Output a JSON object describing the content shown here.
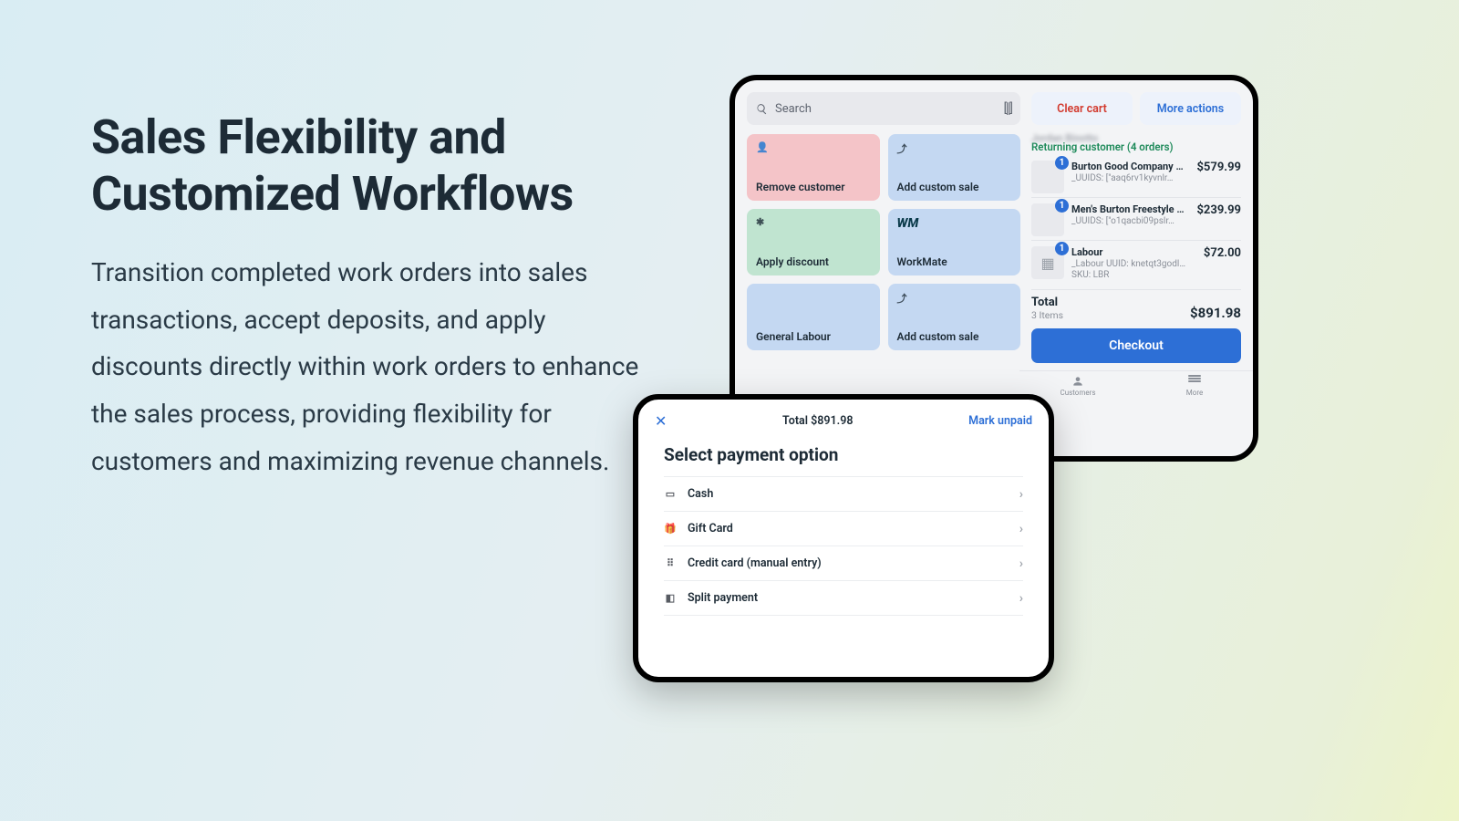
{
  "copy": {
    "title": "Sales Flexibility and Customized Workflows",
    "body": "Transition completed work orders into sales transactions, accept deposits, and apply discounts directly within work orders to enhance the sales process, providing flexibility for customers and maximizing revenue channels."
  },
  "pos": {
    "search_placeholder": "Search",
    "clear_label": "Clear cart",
    "more_label": "More actions",
    "customer_name": "Jordan Binotto",
    "returning": "Returning customer (4 orders)",
    "tiles": [
      {
        "label": "Remove customer",
        "color": "t-pink",
        "icon": "person-remove-icon",
        "glyph": "👤"
      },
      {
        "label": "Add custom sale",
        "color": "t-blue",
        "icon": "upload-icon",
        "glyph": "⤴"
      },
      {
        "label": "Apply discount",
        "color": "t-green",
        "icon": "discount-icon",
        "glyph": "✱"
      },
      {
        "label": "WorkMate",
        "color": "t-lblue",
        "icon": "workmate-icon",
        "glyph": "WM"
      },
      {
        "label": "General Labour",
        "color": "t-blue",
        "icon": "labour-icon",
        "glyph": ""
      },
      {
        "label": "Add custom sale",
        "color": "t-blue",
        "icon": "upload-icon",
        "glyph": "⤴"
      }
    ],
    "items": [
      {
        "qty": "1",
        "name": "Burton Good Company Camber…",
        "uuid": "_UUIDS: [\"aaq6rv1kyvnlr…",
        "price": "$579.99",
        "thumb": "ski"
      },
      {
        "qty": "1",
        "name": "Men's Burton Freestyle Re:Flex S…",
        "uuid": "_UUIDS: [\"o1qacbi09pslr…",
        "price": "$239.99",
        "thumb": "binding"
      },
      {
        "qty": "1",
        "name": "Labour",
        "uuid": "_Labour UUID: knetqt3godl…",
        "sku": "SKU: LBR",
        "price": "$72.00",
        "thumb": "blank"
      }
    ],
    "total_label": "Total",
    "total_items": "3 Items",
    "total_value": "$891.98",
    "checkout": "Checkout",
    "nav": [
      {
        "label": "Customers"
      },
      {
        "label": "More"
      }
    ]
  },
  "pay": {
    "total": "Total $891.98",
    "mark_unpaid": "Mark unpaid",
    "heading": "Select payment option",
    "options": [
      {
        "label": "Cash",
        "icon": "cash-icon",
        "glyph": "▭"
      },
      {
        "label": "Gift Card",
        "icon": "gift-card-icon",
        "glyph": "🎁"
      },
      {
        "label": "Credit card (manual entry)",
        "icon": "keypad-icon",
        "glyph": "⠿"
      },
      {
        "label": "Split payment",
        "icon": "split-icon",
        "glyph": "◧"
      }
    ]
  }
}
